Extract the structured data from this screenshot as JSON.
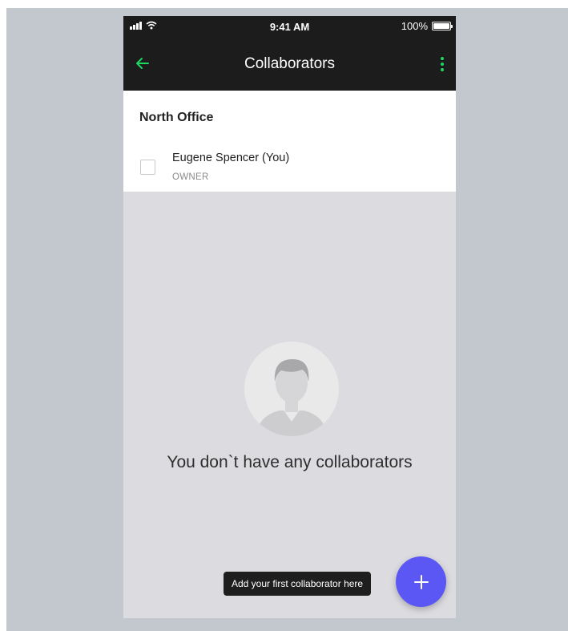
{
  "status_bar": {
    "time": "9:41 AM",
    "battery": "100%"
  },
  "app_bar": {
    "title": "Collaborators"
  },
  "group": {
    "title": "North Office",
    "members": [
      {
        "name": "Eugene Spencer (You)",
        "role": "OWNER",
        "checked": false
      }
    ]
  },
  "empty_state": {
    "message": "You don`t have any collaborators"
  },
  "tooltip": {
    "text": "Add your first collaborator here"
  },
  "icons": {
    "back": "arrow-left-icon",
    "more": "more-vertical-icon",
    "fab": "plus-icon",
    "avatar": "person-placeholder-icon"
  },
  "colors": {
    "accent": "#1ed760",
    "fab": "#5b57f5",
    "app_bar": "#1c1c1c",
    "background": "#dcdce0"
  }
}
